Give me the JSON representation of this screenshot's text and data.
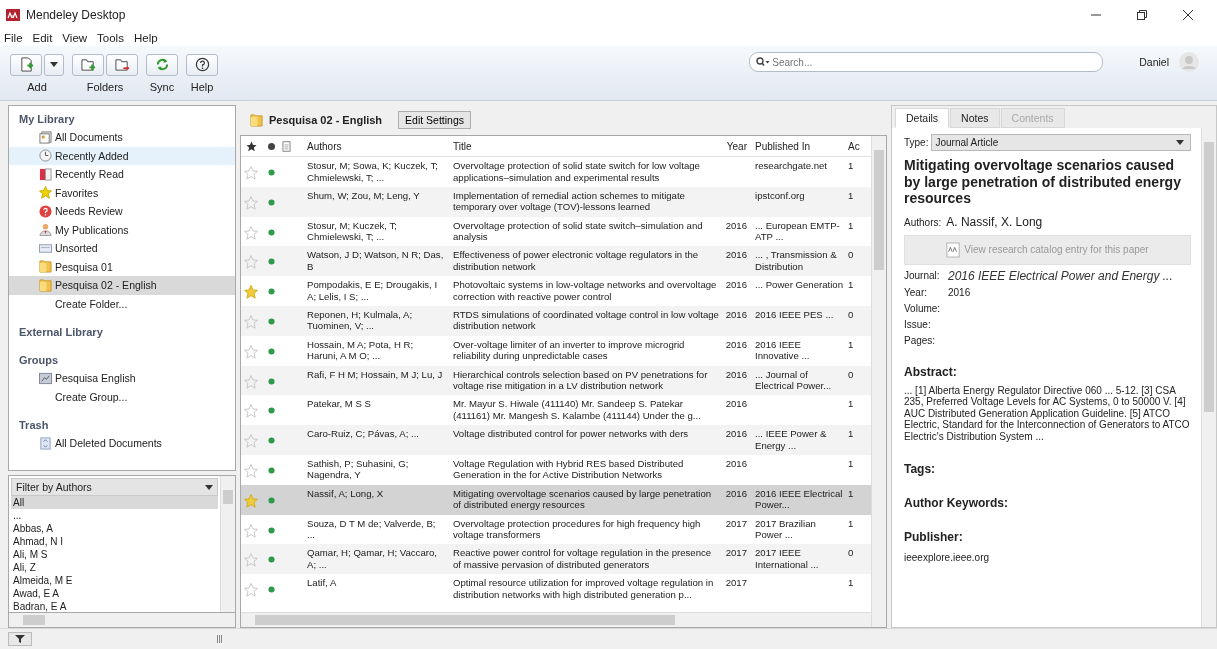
{
  "window": {
    "title": "Mendeley Desktop"
  },
  "menu": [
    "File",
    "Edit",
    "View",
    "Tools",
    "Help"
  ],
  "toolbar": [
    {
      "label": "Add",
      "kind": "add"
    },
    {
      "label": "Folders",
      "kind": "folders"
    },
    {
      "label": "Sync",
      "kind": "sync"
    },
    {
      "label": "Help",
      "kind": "help"
    }
  ],
  "search": {
    "placeholder": "Search..."
  },
  "user": {
    "name": "Daniel"
  },
  "sidebar": {
    "sections": [
      {
        "title": "My Library",
        "items": [
          {
            "label": "All Documents",
            "kind": "documents",
            "selected": false,
            "hovered": false
          },
          {
            "label": "Recently Added",
            "kind": "clock",
            "selected": false,
            "hovered": true
          },
          {
            "label": "Recently Read",
            "kind": "book",
            "selected": false,
            "hovered": false
          },
          {
            "label": "Favorites",
            "kind": "star",
            "selected": false,
            "hovered": false
          },
          {
            "label": "Needs Review",
            "kind": "review",
            "selected": false,
            "hovered": false
          },
          {
            "label": "My Publications",
            "kind": "person",
            "selected": false,
            "hovered": false
          },
          {
            "label": "Unsorted",
            "kind": "unsorted",
            "selected": false,
            "hovered": false
          },
          {
            "label": "Pesquisa 01",
            "kind": "folder",
            "selected": false,
            "hovered": false
          },
          {
            "label": "Pesquisa 02 - English",
            "kind": "folder",
            "selected": true,
            "hovered": false
          },
          {
            "label": "Create Folder...",
            "kind": "action",
            "selected": false,
            "hovered": false
          }
        ]
      },
      {
        "title": "External Library"
      },
      {
        "title": "Groups",
        "items": [
          {
            "label": "Pesquisa English",
            "kind": "group",
            "selected": false,
            "hovered": false
          },
          {
            "label": "Create Group...",
            "kind": "action",
            "selected": false,
            "hovered": false
          }
        ]
      },
      {
        "title": "Trash",
        "items": [
          {
            "label": "All Deleted Documents",
            "kind": "trash",
            "selected": false,
            "hovered": false
          }
        ]
      }
    ]
  },
  "filter": {
    "title": "Filter by Authors",
    "items": [
      {
        "label": "All",
        "selected": true
      },
      {
        "label": "...",
        "selected": false
      },
      {
        "label": "Abbas, A",
        "selected": false
      },
      {
        "label": "Ahmad, N I",
        "selected": false
      },
      {
        "label": "Ali, M S",
        "selected": false
      },
      {
        "label": "Ali, Z",
        "selected": false
      },
      {
        "label": "Almeida, M E",
        "selected": false
      },
      {
        "label": "Awad, E A",
        "selected": false
      },
      {
        "label": "Badran, E A",
        "selected": false
      }
    ]
  },
  "folder": {
    "title": "Pesquisa 02 - English",
    "button": "Edit Settings"
  },
  "table": {
    "columns": [
      "Authors",
      "Title",
      "Year",
      "Published In",
      "Ac"
    ],
    "rows": [
      {
        "favorite": false,
        "selected": false,
        "authors": "Stosur, M; Sowa, K; Kuczek, T; Chmielewski, T; ...",
        "title": "Overvoltage protection of solid state switch for low voltage applications–simulation and experimental results",
        "published": "researchgate.net",
        "ac": "1"
      },
      {
        "favorite": false,
        "selected": false,
        "authors": "Shum, W; Zou, M; Leng, Y",
        "title": "Implementation of remedial action schemes to mitigate temporary over voltage (TOV)-lessons learned",
        "published": "ipstconf.org",
        "ac": "1"
      },
      {
        "favorite": false,
        "selected": false,
        "authors": "Stosur, M; Kuczek, T; Chmielewski, T; ...",
        "title": "Overvoltage protection of solid state switch–simulation and analysis",
        "year": "2016",
        "published": "... European EMTP-ATP ...",
        "ac": "1"
      },
      {
        "favorite": false,
        "selected": false,
        "authors": "Watson, J D; Watson, N R; Das, B",
        "title": "Effectiveness of power electronic voltage regulators in the distribution network",
        "year": "2016",
        "published": "... , Transmission & Distribution",
        "ac": "0"
      },
      {
        "favorite": true,
        "selected": false,
        "authors": "Pompodakis, E E; Drougakis, I A; Lelis, I S; ...",
        "title": "Photovoltaic systems in low-voltage networks and overvoltage correction with reactive power control",
        "year": "2016",
        "published": "... Power Generation",
        "ac": "1"
      },
      {
        "favorite": false,
        "selected": false,
        "authors": "Reponen, H; Kulmala, A; Tuominen, V; ...",
        "title": "RTDS simulations of coordinated voltage control in low voltage distribution network",
        "year": "2016",
        "published": "2016 IEEE PES ...",
        "ac": "0"
      },
      {
        "favorite": false,
        "selected": false,
        "authors": "Hossain, M A; Pota, H R; Haruni, A M O; ...",
        "title": "Over-voltage limiter of an inverter to improve microgrid reliability during unpredictable cases",
        "year": "2016",
        "published": "2016 IEEE Innovative ...",
        "ac": "1"
      },
      {
        "favorite": false,
        "selected": false,
        "authors": "Rafi, F H M; Hossain, M J; Lu, J",
        "title": "Hierarchical controls selection based on PV penetrations for voltage rise mitigation in a LV distribution network",
        "year": "2016",
        "published": "... Journal of Electrical Power...",
        "ac": "0"
      },
      {
        "favorite": false,
        "selected": false,
        "authors": "Patekar, M S S",
        "title": "Mr. Mayur S. Hiwale (411140) Mr. Sandeep S. Patekar (411161) Mr. Mangesh S. Kalambe (411144) Under the g...",
        "year": "2016",
        "ac": "1"
      },
      {
        "favorite": false,
        "selected": false,
        "authors": "Caro-Ruiz, C; Pávas, A; ...",
        "title": "Voltage distributed control for power networks with ders",
        "year": "2016",
        "published": "... IEEE Power & Energy ...",
        "ac": "1"
      },
      {
        "favorite": false,
        "selected": false,
        "authors": "Sathish, P; Suhasini, G; Nagendra, Y",
        "title": "Voltage Regulation with Hybrid RES based Distributed Generation in the for Active Distribution Networks",
        "year": "2016",
        "ac": "1"
      },
      {
        "favorite": true,
        "selected": true,
        "authors": "Nassif, A; Long, X",
        "title": "Mitigating overvoltage scenarios caused by large penetration of distributed energy resources",
        "year": "2016",
        "published": "2016 IEEE Electrical Power...",
        "ac": "1"
      },
      {
        "favorite": false,
        "selected": false,
        "authors": "Souza, D T M de; Valverde, B; ...",
        "title": "Overvoltage protection procedures for high frequency high voltage transformers",
        "year": "2017",
        "published": "2017 Brazilian Power ...",
        "ac": "1"
      },
      {
        "favorite": false,
        "selected": false,
        "authors": "Qamar, H; Qamar, H; Vaccaro, A; ...",
        "title": "Reactive power control for voltage regulation in the presence of massive pervasion of distributed generators",
        "year": "2017",
        "published": "2017 IEEE International ...",
        "ac": "0"
      },
      {
        "favorite": false,
        "selected": false,
        "authors": "Latif, A",
        "title": "Optimal resource utilization for improved voltage regulation in distribution networks with high distributed generation p...",
        "year": "2017",
        "ac": "1"
      }
    ]
  },
  "details": {
    "tabs": [
      {
        "label": "Details",
        "selected": true,
        "disabled": false
      },
      {
        "label": "Notes",
        "selected": false,
        "disabled": false
      },
      {
        "label": "Contents",
        "selected": false,
        "disabled": true
      }
    ],
    "type_label": "Type:",
    "type": "Journal Article",
    "title": "Mitigating overvoltage scenarios caused by large penetration of distributed energy resources",
    "authors_label": "Authors:",
    "authors": "A. Nassif, X. Long",
    "catalog_button": "View research catalog entry for this paper",
    "fields": [
      {
        "label": "Journal:",
        "value": "2016 IEEE Electrical Power and Energy ...",
        "kind": "journal"
      },
      {
        "label": "Year:",
        "value": "2016",
        "kind": "plain"
      },
      {
        "label": "Volume:",
        "kind": "plain"
      },
      {
        "label": "Issue:",
        "kind": "plain"
      },
      {
        "label": "Pages:",
        "kind": "plain"
      }
    ],
    "abstract_label": "Abstract:",
    "abstract": "... [1] Alberta Energy Regulator Directive 060 ... 5-12. [3] CSA 235, Preferred Voltage Levels for AC Systems, 0 to 50000 V. [4] AUC Distributed Generation Application Guideline. [5] ATCO Electric, Standard for the Interconnection of Generators to ATCO Electric's Distribution System ...",
    "tags_label": "Tags:",
    "keywords_label": "Author Keywords:",
    "publisher_label": "Publisher:",
    "publisher": "ieeexplore.ieee.org"
  }
}
